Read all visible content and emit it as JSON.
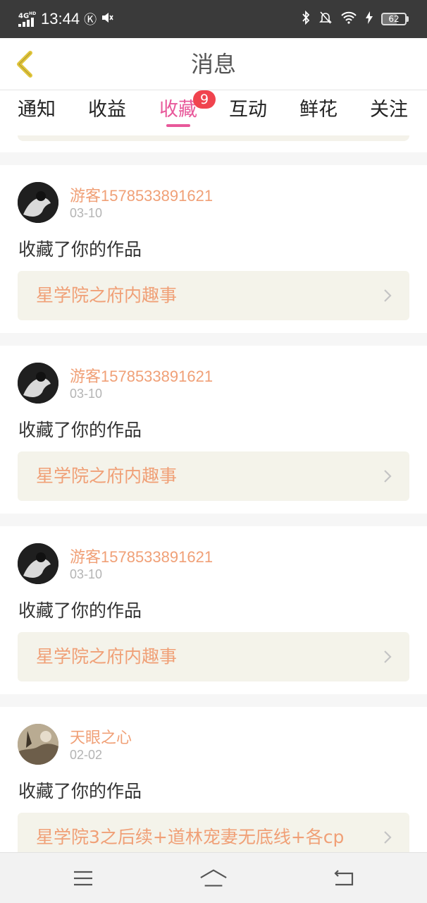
{
  "status_bar": {
    "network": "4G",
    "network_sup": "HD",
    "time": "13:44",
    "battery": "62"
  },
  "header": {
    "title": "消息"
  },
  "tabs": [
    {
      "label": "通知"
    },
    {
      "label": "收益"
    },
    {
      "label": "收藏",
      "badge": "9",
      "active": true
    },
    {
      "label": "互动"
    },
    {
      "label": "鲜花"
    },
    {
      "label": "关注"
    }
  ],
  "messages": [
    {
      "user": "游客1578533891621",
      "date": "03-10",
      "action": "收藏了你的作品",
      "work": "星学院之府内趣事"
    },
    {
      "user": "游客1578533891621",
      "date": "03-10",
      "action": "收藏了你的作品",
      "work": "星学院之府内趣事"
    },
    {
      "user": "游客1578533891621",
      "date": "03-10",
      "action": "收藏了你的作品",
      "work": "星学院之府内趣事"
    },
    {
      "user": "天眼之心",
      "date": "02-02",
      "action": "收藏了你的作品",
      "work": "星学院3之后续+道林宠妻无底线+各cp"
    }
  ],
  "colors": {
    "accent_pink": "#e8589a",
    "username_orange": "#f0a077",
    "badge_red": "#f0434e",
    "back_arrow_yellow": "#e0c43a"
  },
  "icons": {
    "back": "chevron-left-icon",
    "item_arrow": "chevron-right-icon",
    "nav_menu": "menu-icon",
    "nav_home": "home-icon",
    "nav_back": "return-icon"
  }
}
